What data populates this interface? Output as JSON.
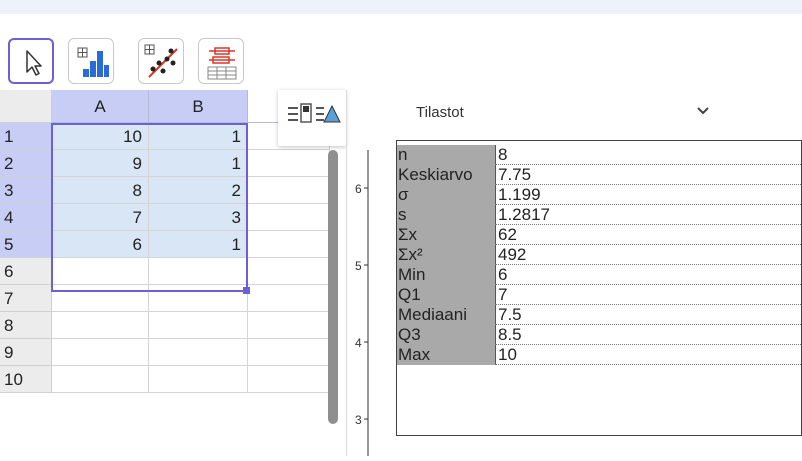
{
  "toolbar": {
    "tools": [
      {
        "name": "move-tool",
        "icon": "pointer-arrow-icon",
        "active": true
      },
      {
        "name": "one-variable-analysis-tool",
        "icon": "histogram-icon",
        "active": false
      },
      {
        "name": "two-variable-regression-tool",
        "icon": "scatter-regression-icon",
        "active": false
      },
      {
        "name": "multi-variable-analysis-tool",
        "icon": "boxplots-icon",
        "active": false
      }
    ]
  },
  "spreadsheet": {
    "columns": [
      "A",
      "B"
    ],
    "row_numbers": [
      "1",
      "2",
      "3",
      "4",
      "5",
      "6",
      "7",
      "8",
      "9",
      "10"
    ],
    "cells": [
      [
        "10",
        "1"
      ],
      [
        "9",
        "1"
      ],
      [
        "8",
        "2"
      ],
      [
        "7",
        "3"
      ],
      [
        "6",
        "1"
      ],
      [
        "",
        ""
      ],
      [
        "",
        ""
      ],
      [
        "",
        ""
      ],
      [
        "",
        ""
      ],
      [
        "",
        ""
      ]
    ],
    "selected_rows": 5
  },
  "axis": {
    "ticks": [
      "6",
      "5",
      "4",
      "3"
    ]
  },
  "stats": {
    "dropdown_label": "Tilastot",
    "rows": [
      {
        "label": "n",
        "value": "8"
      },
      {
        "label": "Keskiarvo",
        "value": "7.75"
      },
      {
        "label": "σ",
        "value": "1.199"
      },
      {
        "label": "s",
        "value": "1.2817"
      },
      {
        "label": "Σx",
        "value": "62"
      },
      {
        "label": "Σx²",
        "value": "492"
      },
      {
        "label": "Min",
        "value": "6"
      },
      {
        "label": "Q1",
        "value": "7"
      },
      {
        "label": "Mediaani",
        "value": "7.5"
      },
      {
        "label": "Q3",
        "value": "8.5"
      },
      {
        "label": "Max",
        "value": "10"
      }
    ]
  },
  "colors": {
    "accent": "#6d5fd4",
    "header_selected": "#c7cdf5",
    "cell_selected": "#d9e6f6",
    "label_gray": "#a9a9a9"
  }
}
